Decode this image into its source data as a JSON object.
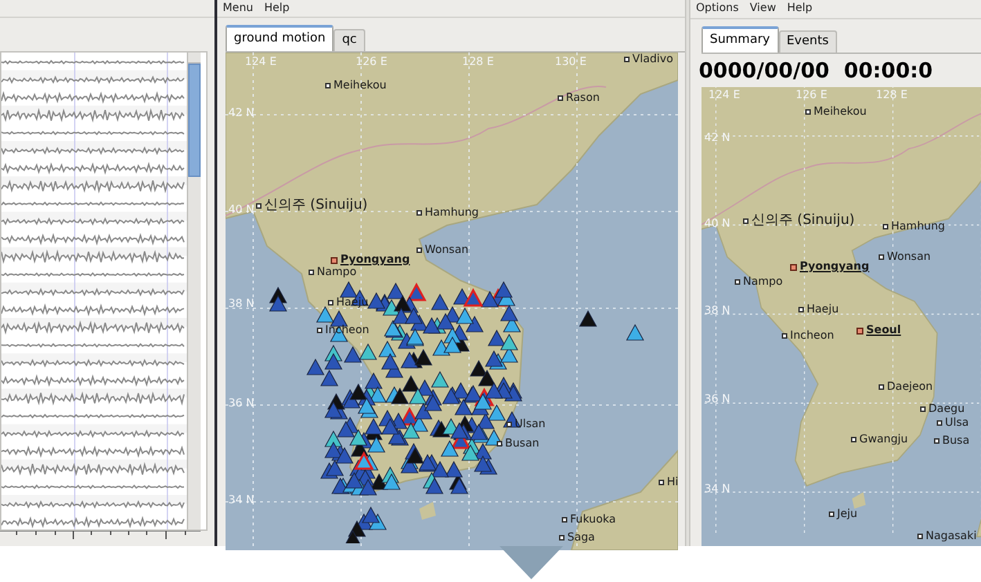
{
  "ground_motion_panel": {
    "menu": [
      "Menu",
      "Help"
    ],
    "tabs": [
      {
        "label": "ground motion",
        "selected": true
      },
      {
        "label": "qc",
        "selected": false
      }
    ],
    "map": {
      "grid_labels": [
        "124 E",
        "126 E",
        "128 E",
        "130 E",
        "42 N",
        "40 N",
        "38 N",
        "36 N",
        "34 N"
      ],
      "places": [
        {
          "name": "Vladivo",
          "kind": "city"
        },
        {
          "name": "Meihekou",
          "kind": "city"
        },
        {
          "name": "Rason",
          "kind": "city"
        },
        {
          "name": "신의주 (Sinuiju)",
          "kind": "city"
        },
        {
          "name": "Hamhung",
          "kind": "city"
        },
        {
          "name": "Wonsan",
          "kind": "city"
        },
        {
          "name": "Pyongyang",
          "kind": "capital"
        },
        {
          "name": "Nampo",
          "kind": "city"
        },
        {
          "name": "Haeju",
          "kind": "city"
        },
        {
          "name": "Incheon",
          "kind": "city"
        },
        {
          "name": "Ulsan",
          "kind": "city"
        },
        {
          "name": "Busan",
          "kind": "city"
        },
        {
          "name": "Hi",
          "kind": "city"
        },
        {
          "name": "Fukuoka",
          "kind": "city"
        },
        {
          "name": "Saga",
          "kind": "city"
        }
      ]
    }
  },
  "summary_panel": {
    "menu": [
      "Options",
      "View",
      "Help"
    ],
    "tabs": [
      {
        "label": "Summary",
        "selected": true
      },
      {
        "label": "Events",
        "selected": false
      }
    ],
    "datetime": "0000/00/00  00:00:0",
    "map": {
      "grid_labels": [
        "124 E",
        "126 E",
        "128 E",
        "42 N",
        "40 N",
        "38 N",
        "36 N",
        "34 N"
      ],
      "places": [
        {
          "name": "Meihekou",
          "kind": "city"
        },
        {
          "name": "신의주 (Sinuiju)",
          "kind": "city"
        },
        {
          "name": "Hamhung",
          "kind": "city"
        },
        {
          "name": "Pyongyang",
          "kind": "capital"
        },
        {
          "name": "Wonsan",
          "kind": "city"
        },
        {
          "name": "Nampo",
          "kind": "city"
        },
        {
          "name": "Haeju",
          "kind": "city"
        },
        {
          "name": "Incheon",
          "kind": "city"
        },
        {
          "name": "Seoul",
          "kind": "capital"
        },
        {
          "name": "Daejeon",
          "kind": "city"
        },
        {
          "name": "Daegu",
          "kind": "city"
        },
        {
          "name": "Ulsa",
          "kind": "city"
        },
        {
          "name": "Gwangju",
          "kind": "city"
        },
        {
          "name": "Busa",
          "kind": "city"
        },
        {
          "name": "Jeju",
          "kind": "city"
        },
        {
          "name": "Nagasaki",
          "kind": "city"
        }
      ]
    }
  }
}
